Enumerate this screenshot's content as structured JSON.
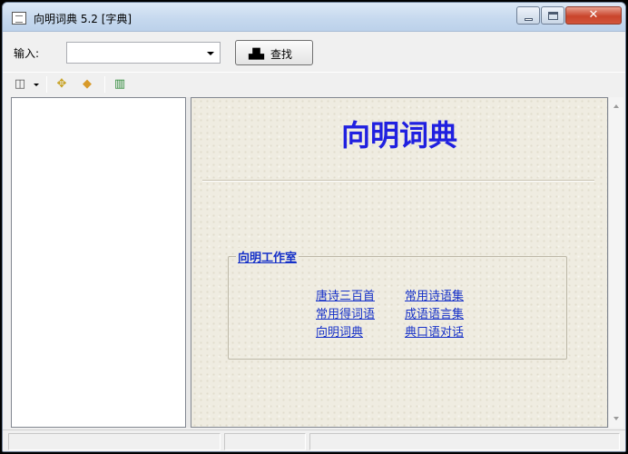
{
  "window": {
    "title": "向明词典 5.2 [字典]",
    "buttons": {
      "minimize": "minimize",
      "maximize": "maximize",
      "close": "close"
    }
  },
  "input_bar": {
    "label": "输入:",
    "combo_value": "",
    "search_button_label": "查找",
    "search_icon": "binoculars-icon"
  },
  "toolbar": {
    "items": [
      {
        "icon": "dictionary-switch-icon"
      },
      {
        "icon": "navigate-icon"
      },
      {
        "icon": "eraser-icon"
      },
      {
        "icon": "book-icon"
      }
    ]
  },
  "content": {
    "title": "向明词典",
    "group_title": "向明工作室",
    "links": [
      "唐诗三百首",
      "常用得词语",
      "向明词典",
      "常用诗语集",
      "成语语言集",
      "典口语对话"
    ]
  },
  "colors": {
    "title_blue": "#2020e0",
    "link_blue": "#1530c8",
    "content_bg": "#efece1"
  }
}
